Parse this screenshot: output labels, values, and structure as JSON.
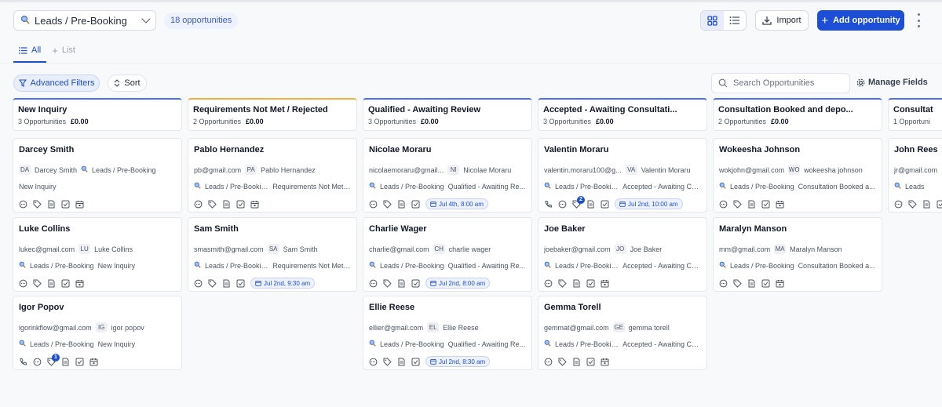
{
  "header": {
    "pipeline": "Leads / Pre-Booking",
    "opportunity_count": "18 opportunities",
    "import_label": "Import",
    "add_label": "Add opportunity"
  },
  "tabs": [
    {
      "label": "All",
      "active": true
    },
    {
      "label": "List",
      "active": false
    }
  ],
  "toolbar": {
    "filters_label": "Advanced Filters",
    "sort_label": "Sort",
    "search_placeholder": "Search Opportunities",
    "manage_fields_label": "Manage Fields"
  },
  "colors": {
    "accent": "#1d4ed8",
    "column_top": "#4c6ef5",
    "rejected_top": "#f5b042"
  },
  "columns": [
    {
      "title": "New Inquiry",
      "count": "3 Opportunities",
      "value": "£0.00",
      "cards": [
        {
          "name": "Darcey Smith",
          "email": "",
          "initials": "DA",
          "contact": "Darcey Smith",
          "pipeline": "Leads / Pre-Booking",
          "stage": "New Inquiry",
          "appt": "",
          "icons": "basic"
        },
        {
          "name": "Luke Collins",
          "email": "lukec@gmail.com",
          "initials": "LU",
          "contact": "Luke Collins",
          "pipeline": "Leads / Pre-Booking",
          "stage": "New Inquiry",
          "appt": "",
          "icons": "basic"
        },
        {
          "name": "Igor Popov",
          "email": "igorinkflow@gmail.com",
          "initials": "IG",
          "contact": "igor popov",
          "pipeline": "Leads / Pre-Booking",
          "stage": "New Inquiry",
          "appt": "",
          "icons": "call",
          "badge": "1"
        }
      ]
    },
    {
      "title": "Requirements Not Met / Rejected",
      "count": "2 Opportunities",
      "value": "£0.00",
      "cards": [
        {
          "name": "Pablo Hernandez",
          "email": "pb@gmail.com",
          "initials": "PA",
          "contact": "Pablo Hernandez",
          "pipeline": "Leads / Pre-Booking",
          "stage": "Requirements Not Met ...",
          "appt": "",
          "icons": "basic"
        },
        {
          "name": "Sam Smith",
          "email": "smasmith@gmail.com",
          "initials": "SA",
          "contact": "Sam Smith",
          "pipeline": "Leads / Pre-Booking",
          "stage": "Requirements Not Met ...",
          "appt": "Jul 2nd, 9:30 am",
          "icons": "basic"
        }
      ]
    },
    {
      "title": "Qualified - Awaiting Review",
      "count": "3 Opportunities",
      "value": "£0.00",
      "cards": [
        {
          "name": "Nicolae Moraru",
          "email": "nicolaemoraru@gmail...",
          "initials": "NI",
          "contact": "Nicolae Moraru",
          "pipeline": "Leads / Pre-Booking",
          "stage": "Qualified - Awaiting Re...",
          "appt": "Jul 4th, 8:00 am",
          "icons": "basic"
        },
        {
          "name": "Charlie Wager",
          "email": "charlie@gmail.com",
          "initials": "CH",
          "contact": "charlie wager",
          "pipeline": "Leads / Pre-Booking",
          "stage": "Qualified - Awaiting Re...",
          "appt": "Jul 2nd, 8:00 am",
          "icons": "basic"
        },
        {
          "name": "Ellie Reese",
          "email": "ellier@gmail.com",
          "initials": "EL",
          "contact": "Ellie Reese",
          "pipeline": "Leads / Pre-Booking",
          "stage": "Qualified - Awaiting Re...",
          "appt": "Jul 2nd, 8:30 am",
          "icons": "basic"
        }
      ]
    },
    {
      "title": "Accepted - Awaiting Consultati...",
      "count": "3 Opportunities",
      "value": "£0.00",
      "cards": [
        {
          "name": "Valentin Moraru",
          "email": "valentin.moraru100@g...",
          "initials": "VA",
          "contact": "Valentin Moraru",
          "pipeline": "Leads / Pre-Booking",
          "stage": "Accepted - Awaiting Co...",
          "appt": "Jul 2nd, 10:00 am",
          "icons": "call",
          "badge": "2"
        },
        {
          "name": "Joe Baker",
          "email": "joebaker@gmail.com",
          "initials": "JO",
          "contact": "Joe Baker",
          "pipeline": "Leads / Pre-Booking",
          "stage": "Accepted - Awaiting Co...",
          "appt": "",
          "icons": "basic"
        },
        {
          "name": "Gemma Torell",
          "email": "gemmat@gmail.com",
          "initials": "GE",
          "contact": "gemma torell",
          "pipeline": "Leads / Pre-Booking",
          "stage": "Accepted - Awaiting Co...",
          "appt": "",
          "icons": "basic"
        }
      ]
    },
    {
      "title": "Consultation Booked and depo...",
      "count": "2 Opportunities",
      "value": "£0.00",
      "cards": [
        {
          "name": "Wokeesha Johnson",
          "email": "wokjohn@gmail.com",
          "initials": "WO",
          "contact": "wokeesha johnson",
          "pipeline": "Leads / Pre-Booking",
          "stage": "Consultation Booked a...",
          "appt": "",
          "icons": "basic"
        },
        {
          "name": "Maralyn Manson",
          "email": "mm@gmail.com",
          "initials": "MA",
          "contact": "Maralyn Manson",
          "pipeline": "Leads / Pre-Booking",
          "stage": "Consultation Booked a...",
          "appt": "",
          "icons": "basic"
        }
      ]
    },
    {
      "title": "Consultat",
      "count": "1 Opportuni",
      "value": "",
      "cards": [
        {
          "name": "John Rees",
          "email": "jr@gmail.com",
          "initials": "",
          "contact": "",
          "pipeline": "Leads",
          "stage": "",
          "appt": "",
          "icons": "basic"
        }
      ]
    }
  ]
}
